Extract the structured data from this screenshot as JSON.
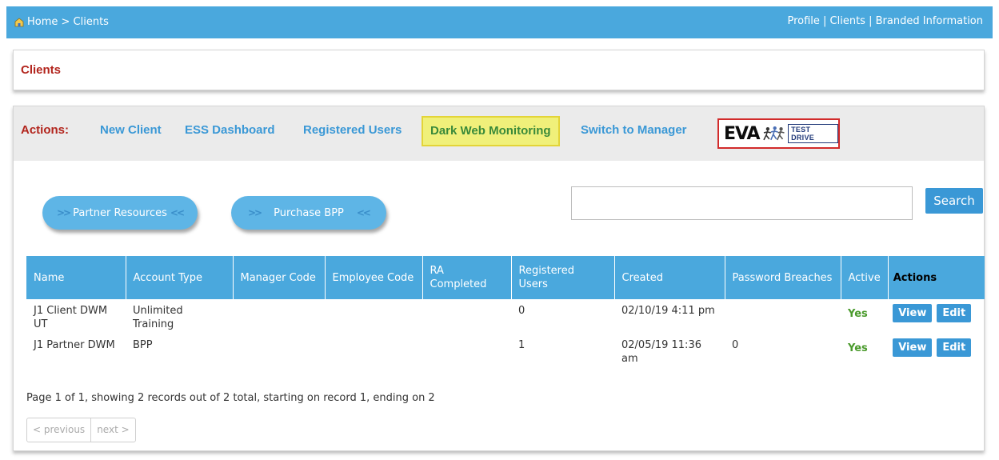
{
  "topbar": {
    "breadcrumb": "Home > Clients",
    "links": [
      "Profile",
      "Clients",
      "Branded Information"
    ],
    "separator": "|"
  },
  "clients_header": {
    "title": "Clients"
  },
  "actions": {
    "label": "Actions:",
    "links": [
      "New Client",
      "ESS Dashboard",
      "Registered Users",
      "Dark Web Monitoring",
      "Switch to Manager"
    ],
    "eva_badge": {
      "logo_text": "EVA",
      "tag": "TEST DRIVE"
    }
  },
  "buttons": {
    "partner_resources": "Partner Resources",
    "purchase_bpp": "Purchase BPP",
    "search": "Search",
    "arrows_right": ">>",
    "arrows_left": "<<"
  },
  "search": {
    "value": ""
  },
  "table": {
    "headers": [
      "Name",
      "Account Type",
      "Manager Code",
      "Employee Code",
      "RA Completed",
      "Registered Users",
      "Created",
      "Password Breaches",
      "Active",
      "Actions"
    ],
    "rows": [
      {
        "name": "J1 Client DWM UT",
        "account_type": "Unlimited Training",
        "manager_code": "",
        "employee_code": "",
        "ra_completed": "",
        "registered_users": "0",
        "created": "02/10/19 4:11 pm",
        "password_breaches": "",
        "active": "Yes",
        "view": "View",
        "edit": "Edit"
      },
      {
        "name": "J1 Partner DWM",
        "account_type": "BPP",
        "manager_code": "",
        "employee_code": "",
        "ra_completed": "",
        "registered_users": "1",
        "created": "02/05/19 11:36 am",
        "password_breaches": "0",
        "active": "Yes",
        "view": "View",
        "edit": "Edit"
      }
    ]
  },
  "summary": "Page 1 of 1, showing 2 records out of 2 total, starting on record 1, ending on 2",
  "pager": {
    "previous": "< previous",
    "next": "next >"
  },
  "colors": {
    "primary_blue": "#4aa8dd",
    "link_blue": "#3a98d6",
    "accent_red": "#b2241c",
    "active_green": "#4a9a2c",
    "highlight_yellow": "#f0f07a"
  },
  "icons": {
    "home": "home-icon"
  }
}
